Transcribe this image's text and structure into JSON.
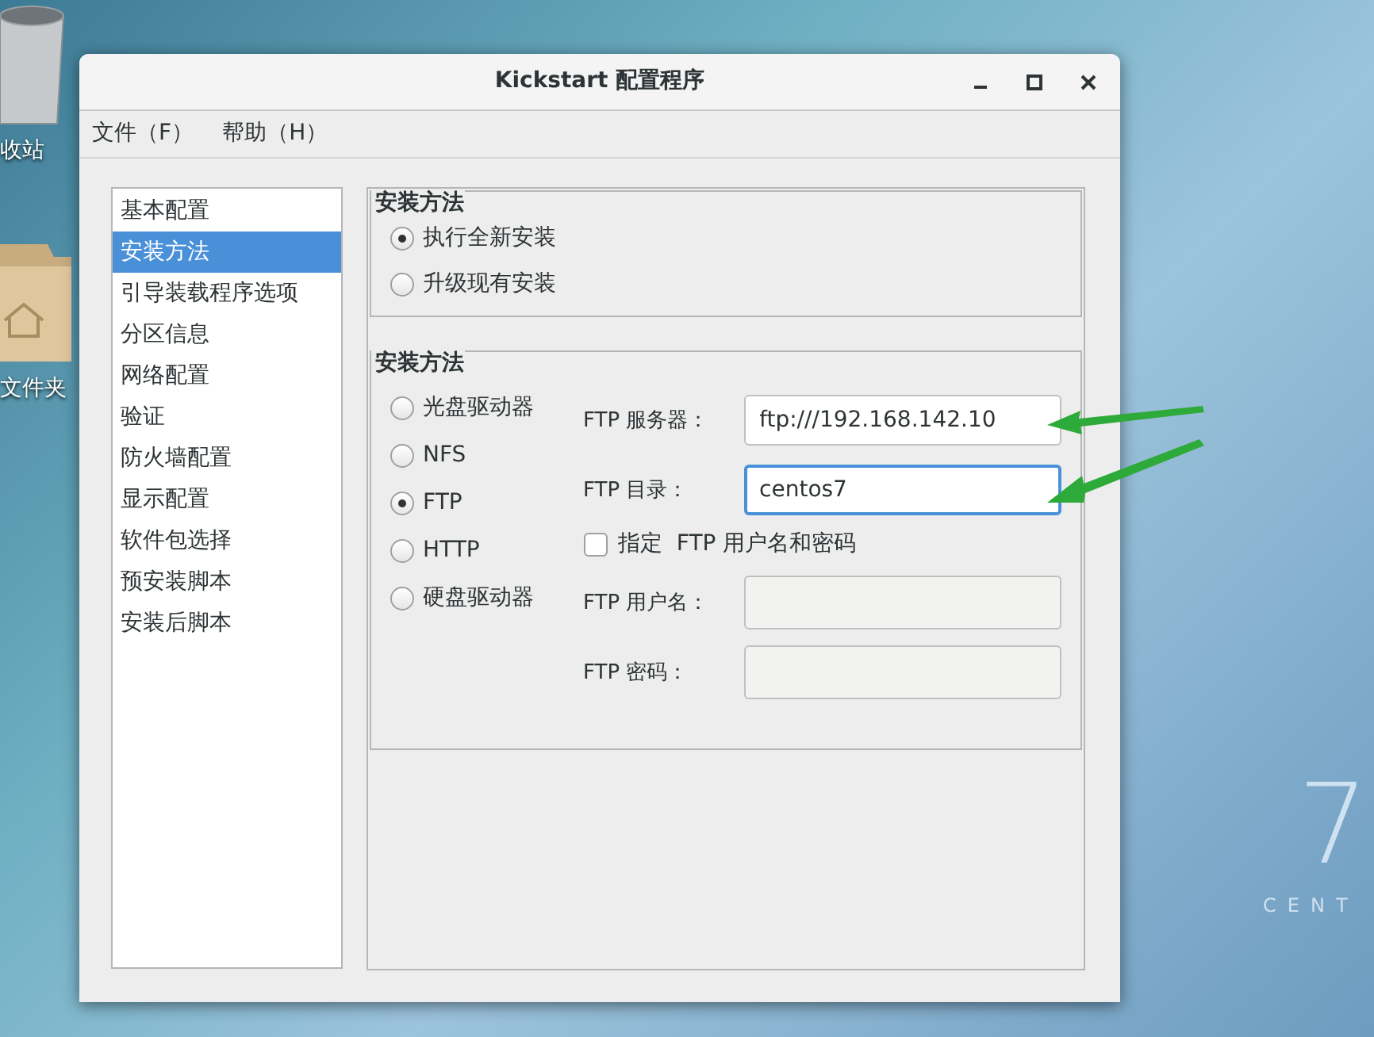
{
  "desktop": {
    "icons": [
      {
        "kind": "trash",
        "label": "收站"
      },
      {
        "kind": "folder",
        "label": "文件夹"
      }
    ],
    "wallpaper_logo": {
      "number": "7",
      "text": "CENT"
    }
  },
  "window": {
    "title": "Kickstart 配置程序",
    "menu": [
      "文件（F）",
      "帮助（H）"
    ],
    "sidebar": {
      "items": [
        {
          "label": "基本配置",
          "selected": false
        },
        {
          "label": "安装方法",
          "selected": true
        },
        {
          "label": "引导装载程序选项",
          "selected": false
        },
        {
          "label": "分区信息",
          "selected": false
        },
        {
          "label": "网络配置",
          "selected": false
        },
        {
          "label": "验证",
          "selected": false
        },
        {
          "label": "防火墙配置",
          "selected": false
        },
        {
          "label": "显示配置",
          "selected": false
        },
        {
          "label": "软件包选择",
          "selected": false
        },
        {
          "label": "预安装脚本",
          "selected": false
        },
        {
          "label": "安装后脚本",
          "selected": false
        }
      ]
    },
    "install_type": {
      "title": "安装方法",
      "options": [
        {
          "label": "执行全新安装",
          "selected": true
        },
        {
          "label": "升级现有安装",
          "selected": false
        }
      ]
    },
    "install_method": {
      "title": "安装方法",
      "options": [
        {
          "label": "光盘驱动器",
          "selected": false
        },
        {
          "label": "NFS",
          "selected": false
        },
        {
          "label": "FTP",
          "selected": true
        },
        {
          "label": "HTTP",
          "selected": false
        },
        {
          "label": "硬盘驱动器",
          "selected": false
        }
      ],
      "fields": [
        {
          "label": "FTP 服务器：",
          "value": "ftp:///192.168.142.10",
          "focused": false
        },
        {
          "label": "FTP 目录：",
          "value": "centos7",
          "focused": true
        }
      ],
      "auth_checkbox": {
        "label": "指定  FTP 用户名和密码",
        "checked": false
      },
      "auth_fields": [
        {
          "label": "FTP 用户名：",
          "disabled": true
        },
        {
          "label": "FTP 密码：",
          "disabled": true
        }
      ]
    }
  }
}
